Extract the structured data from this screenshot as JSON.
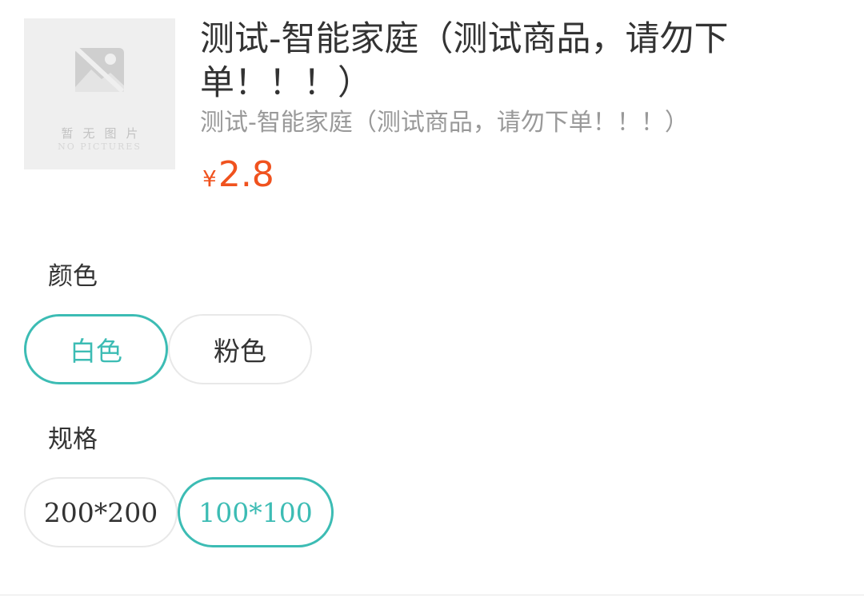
{
  "product": {
    "image_placeholder": {
      "caption": "暂无图片",
      "caption_en": "NO PICTURES"
    },
    "title": "测试-智能家庭（测试商品，请勿下单！！！）",
    "subtitle": "测试-智能家庭（测试商品，请勿下单！！！）",
    "price": {
      "currency": "¥",
      "amount": "2.8",
      "color": "#f0521e"
    }
  },
  "options": {
    "color": {
      "label": "颜色",
      "choices": [
        "白色",
        "粉色"
      ],
      "selected": "白色"
    },
    "spec": {
      "label": "规格",
      "choices": [
        "200*200",
        "100*100"
      ],
      "selected": "100*100"
    }
  },
  "theme": {
    "accent": "#3cbcb4",
    "border": "#e8e8e8"
  }
}
